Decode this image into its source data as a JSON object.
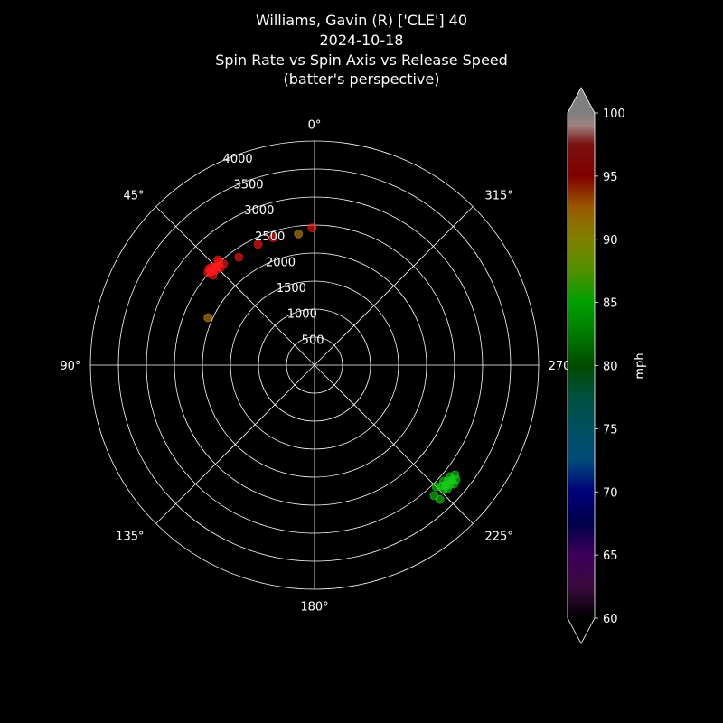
{
  "title": {
    "line1": "Williams, Gavin (R) ['CLE'] 40",
    "line2": "2024-10-18",
    "line3": "Spin Rate vs Spin Axis vs Release Speed",
    "line4": "(batter's perspective)"
  },
  "chart_data": {
    "type": "scatter",
    "projection": "polar",
    "theta_direction": "counterclockwise",
    "theta_zero": "top",
    "theta_label": "spin axis (deg)",
    "r_label": "spin rate (rpm)",
    "r_lim": [
      0,
      4000
    ],
    "r_ticks": [
      500,
      1000,
      1500,
      2000,
      2500,
      3000,
      3500,
      4000
    ],
    "r_tick_labels": [
      "500",
      "1000",
      "1500",
      "2000",
      "2500",
      "3000",
      "3500",
      "4000"
    ],
    "theta_ticks": [
      0,
      45,
      90,
      135,
      180,
      225,
      270,
      315
    ],
    "theta_tick_labels": [
      "0°",
      "45°",
      "90°",
      "135°",
      "180°",
      "225°",
      "270°",
      "315°"
    ],
    "grid": true,
    "colorbar": {
      "label": "mph",
      "min": 60,
      "max": 100,
      "ticks": [
        60,
        65,
        70,
        75,
        80,
        85,
        90,
        95,
        100
      ],
      "extend": "both",
      "stops": [
        {
          "v": 60,
          "c": "#000000"
        },
        {
          "v": 62.5,
          "c": "#3a0a3e"
        },
        {
          "v": 65,
          "c": "#3c005a"
        },
        {
          "v": 67.5,
          "c": "#00004a"
        },
        {
          "v": 70,
          "c": "#00007a"
        },
        {
          "v": 72.5,
          "c": "#004a7a"
        },
        {
          "v": 75,
          "c": "#005060"
        },
        {
          "v": 77.5,
          "c": "#005040"
        },
        {
          "v": 80,
          "c": "#004a00"
        },
        {
          "v": 82.5,
          "c": "#007a00"
        },
        {
          "v": 85,
          "c": "#00a000"
        },
        {
          "v": 87.5,
          "c": "#509000"
        },
        {
          "v": 90,
          "c": "#808000"
        },
        {
          "v": 92.5,
          "c": "#9a5a00"
        },
        {
          "v": 95,
          "c": "#800000"
        },
        {
          "v": 97.5,
          "c": "#7a1010"
        },
        {
          "v": 99,
          "c": "#a08080"
        },
        {
          "v": 100,
          "c": "#808080"
        }
      ],
      "over_color": "#808080",
      "under_color": "#000000"
    },
    "points": [
      {
        "theta": 1,
        "r": 2450,
        "speed": 95.5
      },
      {
        "theta": 7,
        "r": 2360,
        "speed": 91.0
      },
      {
        "theta": 18,
        "r": 2390,
        "speed": 96.0
      },
      {
        "theta": 25,
        "r": 2380,
        "speed": 95.3
      },
      {
        "theta": 35,
        "r": 2350,
        "speed": 95.8
      },
      {
        "theta": 42,
        "r": 2430,
        "speed": 95.8
      },
      {
        "theta": 42.5,
        "r": 2550,
        "speed": 96.2
      },
      {
        "theta": 43,
        "r": 2500,
        "speed": 96.0
      },
      {
        "theta": 44,
        "r": 2420,
        "speed": 96.0
      },
      {
        "theta": 44.5,
        "r": 2470,
        "speed": 96.1
      },
      {
        "theta": 45.5,
        "r": 2500,
        "speed": 96.3
      },
      {
        "theta": 46,
        "r": 2450,
        "speed": 96.0
      },
      {
        "theta": 46.5,
        "r": 2530,
        "speed": 96.2
      },
      {
        "theta": 47,
        "r": 2470,
        "speed": 96.4
      },
      {
        "theta": 47.5,
        "r": 2550,
        "speed": 96.0
      },
      {
        "theta": 48,
        "r": 2490,
        "speed": 96.1
      },
      {
        "theta": 48.5,
        "r": 2420,
        "speed": 96.3
      },
      {
        "theta": 49,
        "r": 2520,
        "speed": 96.0
      },
      {
        "theta": 66,
        "r": 2080,
        "speed": 92.0
      },
      {
        "theta": 222.5,
        "r": 3160,
        "speed": 84.5
      },
      {
        "theta": 223,
        "r": 3280,
        "speed": 84.0
      },
      {
        "theta": 225,
        "r": 3070,
        "speed": 84.2
      },
      {
        "theta": 226,
        "r": 3200,
        "speed": 83.5
      },
      {
        "theta": 226.5,
        "r": 3130,
        "speed": 84.3
      },
      {
        "theta": 227,
        "r": 3240,
        "speed": 84.1
      },
      {
        "theta": 227.5,
        "r": 3170,
        "speed": 84.6
      },
      {
        "theta": 228,
        "r": 3100,
        "speed": 83.8
      },
      {
        "theta": 228.5,
        "r": 3220,
        "speed": 84.0
      },
      {
        "theta": 229,
        "r": 3150,
        "speed": 84.4
      },
      {
        "theta": 229.5,
        "r": 3270,
        "speed": 84.2
      },
      {
        "theta": 230,
        "r": 3200,
        "speed": 83.9
      },
      {
        "theta": 230.5,
        "r": 3130,
        "speed": 84.5
      },
      {
        "theta": 231,
        "r": 3250,
        "speed": 84.0
      },
      {
        "theta": 232,
        "r": 3180,
        "speed": 84.3
      }
    ]
  }
}
